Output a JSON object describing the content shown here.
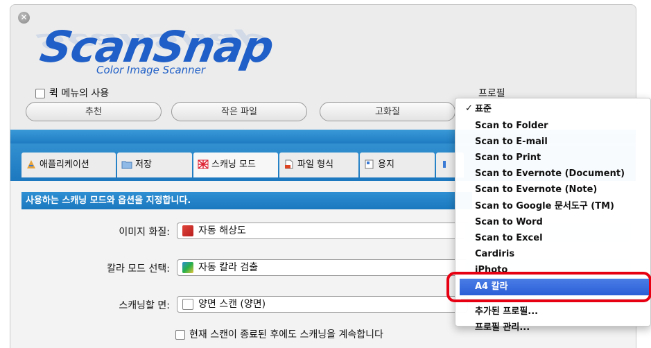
{
  "window": {
    "close_glyph": "✕"
  },
  "logo": {
    "main": "ScanSnap",
    "sub": "Color Image Scanner"
  },
  "quick_menu": {
    "label": "퀵 메뉴의 사용"
  },
  "profile": {
    "label": "프로필"
  },
  "preset_buttons": [
    "추천",
    "작은 파일",
    "고화질"
  ],
  "tabs": [
    {
      "label": "애플리케이션",
      "icon": "app-icon"
    },
    {
      "label": "저장",
      "icon": "folder-icon"
    },
    {
      "label": "스캐닝 모드",
      "icon": "scan-mode-icon"
    },
    {
      "label": "파일 형식",
      "icon": "file-format-icon"
    },
    {
      "label": "용지",
      "icon": "paper-icon"
    }
  ],
  "content": {
    "banner": "사용하는 스캐닝 모드와 옵션을 지정합니다.",
    "image_quality": {
      "label": "이미지 화질:",
      "value": "자동 해상도"
    },
    "color_mode": {
      "label": "칼라 모드 선택:",
      "value": "자동 칼라 검출"
    },
    "scan_side": {
      "label": "스캐닝할 면:",
      "value": "양면 스캔 (양면)"
    },
    "continue_label": "현재 스캔이 종료된 후에도 스캐닝을 계속합니다"
  },
  "menu": {
    "checked_item": "표준",
    "check_glyph": "✓",
    "items": [
      "Scan to Folder",
      "Scan to E-mail",
      "Scan to Print",
      "Scan to Evernote (Document)",
      "Scan to Evernote (Note)",
      "Scan to Google 문서도구 (TM)",
      "Scan to Word",
      "Scan to Excel",
      "Cardiris",
      "iPhoto"
    ],
    "highlighted_item": "A4 칼라",
    "footer_items": [
      "추가된 프로필...",
      "프로필 관리..."
    ]
  },
  "colors": {
    "accent_blue": "#1e7bc2",
    "highlight": "#2a5ed6",
    "annotation_red": "#e60012",
    "logo_blue": "#1f5fc7"
  }
}
